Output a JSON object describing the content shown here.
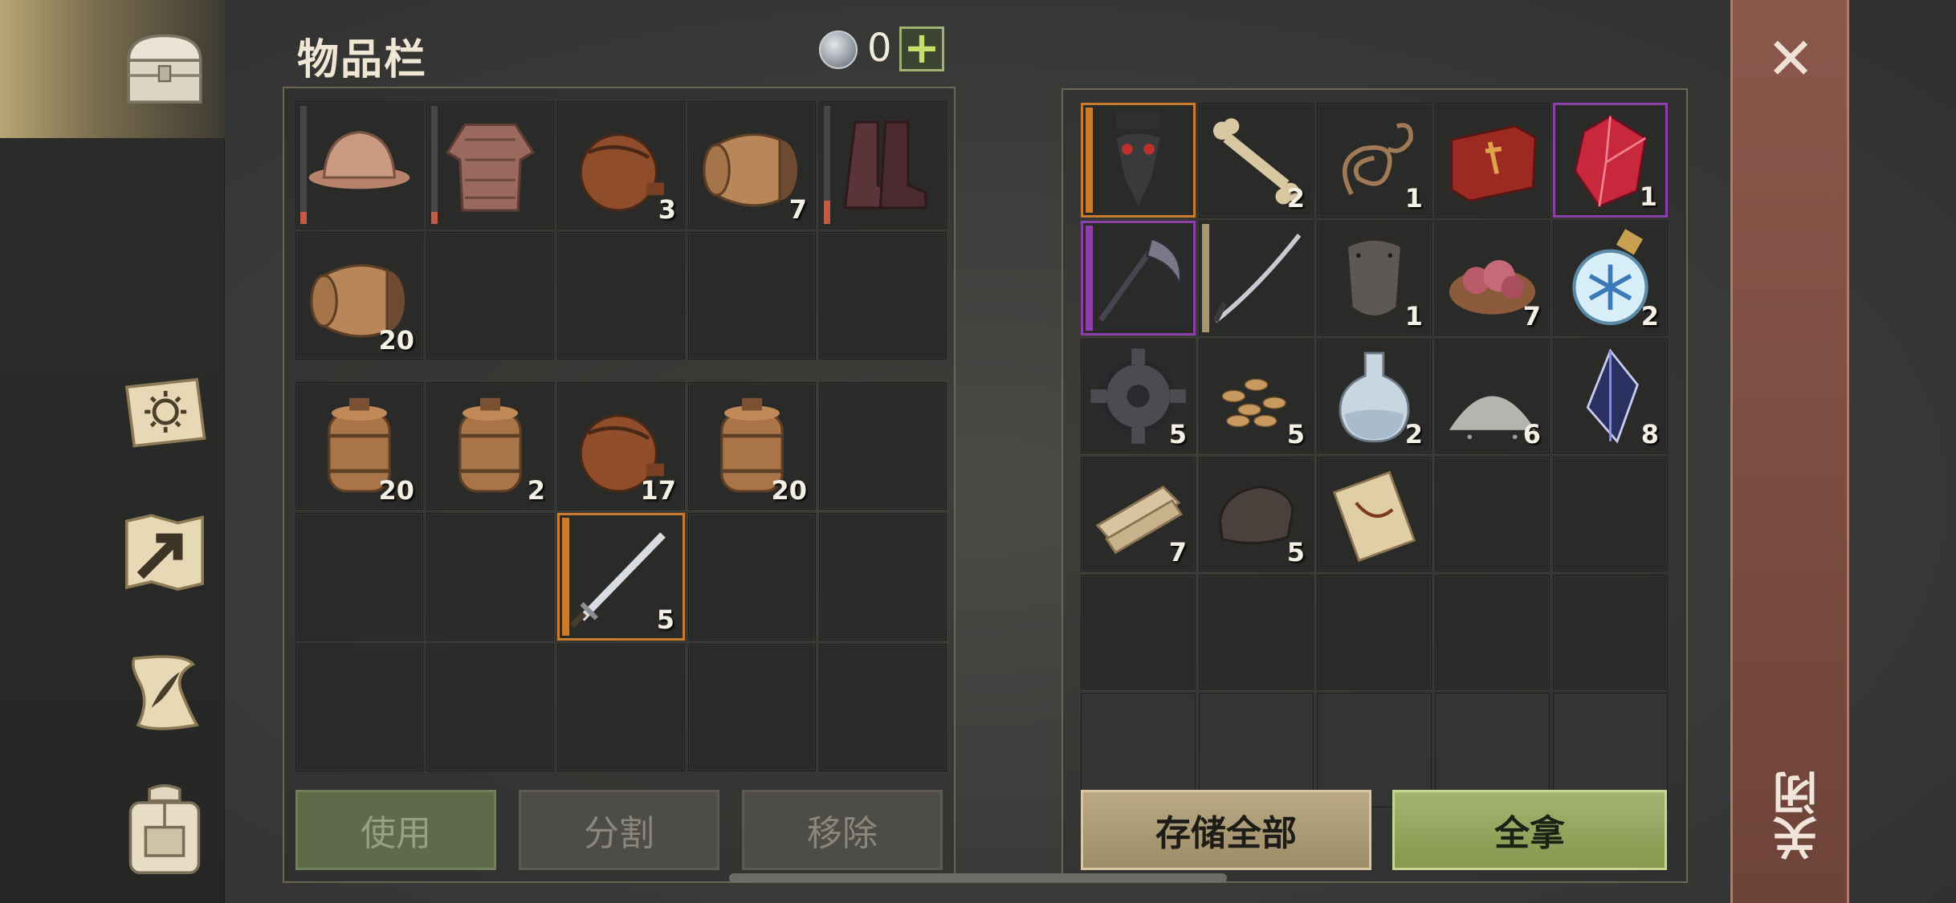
{
  "header": {
    "title": "物品栏",
    "coin_count": "0",
    "add_label": "+"
  },
  "inventory": {
    "equip_rows": [
      [
        {
          "name": "helmet",
          "count": "",
          "durability": 0.1
        },
        {
          "name": "chainmail",
          "count": "",
          "durability": 0.1
        },
        {
          "name": "waterskin",
          "count": "3"
        },
        {
          "name": "barrel",
          "count": "7"
        },
        {
          "name": "boots",
          "count": "",
          "durability": 0.2
        }
      ],
      [
        {
          "name": "barrel",
          "count": "20"
        },
        {
          "name": "",
          "count": ""
        },
        {
          "name": "",
          "count": ""
        },
        {
          "name": "",
          "count": ""
        },
        {
          "name": "",
          "count": ""
        }
      ]
    ],
    "bag_rows": [
      [
        {
          "name": "keg",
          "count": "20"
        },
        {
          "name": "keg",
          "count": "2"
        },
        {
          "name": "waterskin",
          "count": "17"
        },
        {
          "name": "keg",
          "count": "20"
        },
        {
          "name": "",
          "count": ""
        }
      ],
      [
        {
          "name": "",
          "count": ""
        },
        {
          "name": "",
          "count": ""
        },
        {
          "name": "sword",
          "count": "5",
          "selected": true
        },
        {
          "name": "",
          "count": ""
        },
        {
          "name": "",
          "count": ""
        }
      ],
      [
        {
          "name": "",
          "count": ""
        },
        {
          "name": "",
          "count": ""
        },
        {
          "name": "",
          "count": ""
        },
        {
          "name": "",
          "count": ""
        },
        {
          "name": "",
          "count": ""
        }
      ]
    ]
  },
  "storage": {
    "rows": [
      [
        {
          "name": "plague-mask",
          "count": "",
          "highlight": "orange"
        },
        {
          "name": "bone",
          "count": "2"
        },
        {
          "name": "rope",
          "count": "1"
        },
        {
          "name": "red-book",
          "count": ""
        },
        {
          "name": "red-gem",
          "count": "1",
          "highlight": "purple"
        }
      ],
      [
        {
          "name": "scythe",
          "count": "",
          "highlight": "purple-bar"
        },
        {
          "name": "katana",
          "count": "",
          "highlight": "tan-bar"
        },
        {
          "name": "leather-piece",
          "count": "1"
        },
        {
          "name": "meat-bowl",
          "count": "7"
        },
        {
          "name": "frost-potion",
          "count": "2"
        }
      ],
      [
        {
          "name": "gear",
          "count": "5"
        },
        {
          "name": "seeds",
          "count": "5"
        },
        {
          "name": "potion-bottle",
          "count": "2"
        },
        {
          "name": "powder",
          "count": "6"
        },
        {
          "name": "dark-crystal",
          "count": "8"
        }
      ],
      [
        {
          "name": "planks",
          "count": "7"
        },
        {
          "name": "iron-ingot",
          "count": "5"
        },
        {
          "name": "scroll",
          "count": ""
        },
        {
          "name": "",
          "count": ""
        },
        {
          "name": "",
          "count": ""
        }
      ],
      [
        {
          "name": "",
          "count": ""
        },
        {
          "name": "",
          "count": ""
        },
        {
          "name": "",
          "count": ""
        },
        {
          "name": "",
          "count": ""
        },
        {
          "name": "",
          "count": ""
        }
      ],
      [
        {
          "name": "",
          "count": ""
        },
        {
          "name": "",
          "count": ""
        },
        {
          "name": "",
          "count": ""
        },
        {
          "name": "",
          "count": ""
        },
        {
          "name": "",
          "count": ""
        }
      ]
    ]
  },
  "buttons": {
    "use": "使用",
    "split": "分割",
    "remove": "移除",
    "store_all": "存储全部",
    "take_all": "全拿"
  },
  "close": {
    "label": "关闭",
    "x": "✕"
  },
  "nav": {
    "items": [
      "chest-icon",
      "journal-sun-icon",
      "map-arrow-icon",
      "quest-scroll-icon",
      "backpack-icon"
    ]
  },
  "colors": {
    "accent_green": "#9fb173",
    "select_orange": "#c97b2e",
    "rarity_purple": "#8c3fa8",
    "close_red": "#7c4c40"
  }
}
